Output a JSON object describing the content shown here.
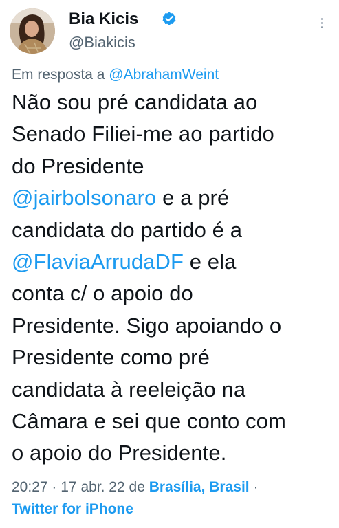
{
  "author": {
    "display_name": "Bia Kicis",
    "handle": "@Biakicis",
    "verified_icon": "verified-badge-icon"
  },
  "reply": {
    "prefix": "Em resposta a",
    "mention": "@AbrahamWeint"
  },
  "tweet": {
    "lines": [
      [
        {
          "text": "Não sou pré candidata ao",
          "link": false
        }
      ],
      [
        {
          "text": "Senado Filiei-me ao partido",
          "link": false
        }
      ],
      [
        {
          "text": "do Presidente",
          "link": false
        }
      ],
      [
        {
          "text": "@jairbolsonaro",
          "link": true
        },
        {
          "text": " e a pré",
          "link": false
        }
      ],
      [
        {
          "text": "candidata do partido é a",
          "link": false
        }
      ],
      [
        {
          "text": "@FlaviaArrudaDF",
          "link": true
        },
        {
          "text": " e ela",
          "link": false
        }
      ],
      [
        {
          "text": "conta c/ o apoio do",
          "link": false
        }
      ],
      [
        {
          "text": "Presidente. Sigo apoiando o",
          "link": false
        }
      ],
      [
        {
          "text": "Presidente como pré",
          "link": false
        }
      ],
      [
        {
          "text": "candidata à reeleição na",
          "link": false
        }
      ],
      [
        {
          "text": "Câmara e sei que conto com",
          "link": false
        }
      ],
      [
        {
          "text": "o apoio do Presidente.",
          "link": false
        }
      ]
    ]
  },
  "meta": {
    "time": "20:27",
    "separator": "·",
    "date": "17 abr. 22",
    "location_prefix": "de",
    "location": "Brasília, Brasil",
    "trailing_separator": "·",
    "source": "Twitter for iPhone"
  },
  "colors": {
    "link": "#1d9bf0",
    "secondary_text": "#536471",
    "primary_text": "#0f1419"
  },
  "icons": {
    "more": "more-options-icon"
  }
}
